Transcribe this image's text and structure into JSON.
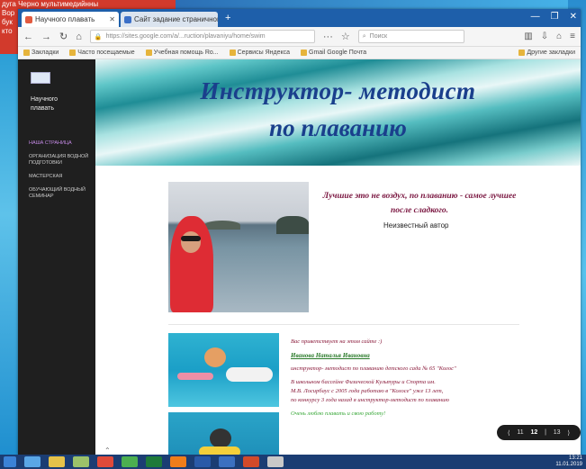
{
  "desktop": {
    "corner_text_lines": [
      "дуга    Черно    мультимедийнны",
      "   Вор",
      "бук",
      "кто"
    ]
  },
  "browser": {
    "tabs": [
      {
        "title": "Научного плавать",
        "active": true
      },
      {
        "title": "Сайт задание страничной",
        "active": false
      }
    ],
    "new_tab_symbol": "+",
    "url": "https://sites.google.com/a/...ruction/plavaniyu/home/swim",
    "search_placeholder": "Поиск",
    "bookmarks": [
      "Закладки",
      "Часто посещаемые",
      "Учебная помощь Ro...",
      "Сервисы Яндекса",
      "Gmail Google Почта"
    ],
    "other_bookmarks": "Другие закладки",
    "window_controls": [
      "—",
      "❐",
      "✕"
    ]
  },
  "sidebar": {
    "site_title_line1": "Научного",
    "site_title_line2": "плавать",
    "items": [
      {
        "label": "Наша страница",
        "active": true
      },
      {
        "label": "Организация водной подготовки",
        "active": false
      },
      {
        "label": "Мастерская",
        "active": false
      },
      {
        "label": "Обучающий водный семинар",
        "active": false
      }
    ]
  },
  "hero": {
    "title_line1": "Инструктор- методист",
    "title_line2": "по плаванию"
  },
  "quote": {
    "text": "Лучшие это не воздух, по плаванию - самое лучшее после сладкого.",
    "author": "Неизвестный автор"
  },
  "info": {
    "intro": "Вас приветствует на этом сайте :)",
    "name": "Иванова Наталья Ивановна",
    "line1": "инструктор- методист по плаванию детского сада № 65 \"Колос\"",
    "line2": "В школьном бассейне Физической Культуры и Спорта им.",
    "line3": "М.В. Лосирбаус с 2005 года работаю в \"Колосе\" уже 13 лет,",
    "line4": "по конкурсу 3 года назад я инструктор-методист по плаванию",
    "closing": "Очень люблю плавать и свою работу!"
  },
  "pagination": {
    "items": [
      "⟨",
      "11",
      "12",
      "|",
      "13",
      "⟩"
    ],
    "current_index": 2
  },
  "taskbar": {
    "clock_time": "13:21",
    "clock_date": "11.01.2019"
  }
}
